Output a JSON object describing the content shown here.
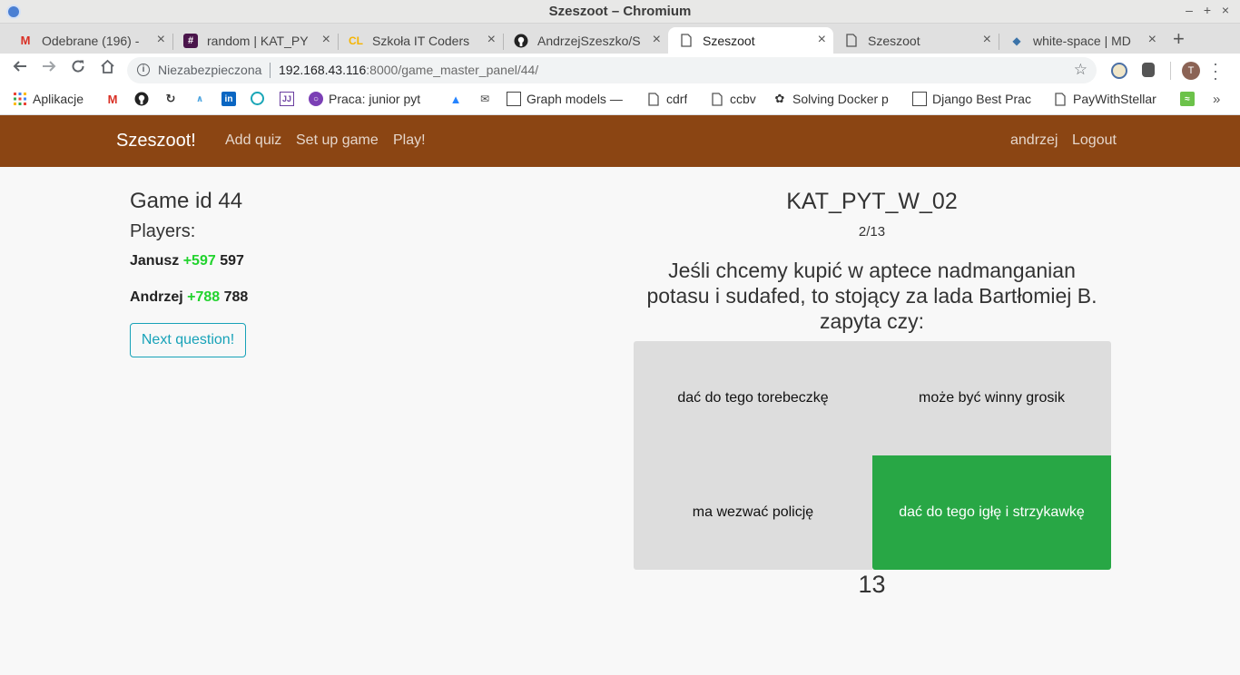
{
  "window": {
    "title": "Szeszoot – Chromium",
    "controls": {
      "minimize": "–",
      "maximize": "+",
      "close": "×"
    }
  },
  "tabs": [
    {
      "label": "Odebrane (196) - ",
      "icon": "gmail-icon",
      "active": false
    },
    {
      "label": "random | KAT_PY",
      "icon": "slack-icon",
      "active": false
    },
    {
      "label": "Szkoła IT Coders",
      "icon": "coderslab-icon",
      "active": false
    },
    {
      "label": "AndrzejSzeszko/S",
      "icon": "github-icon",
      "active": false
    },
    {
      "label": "Szeszoot",
      "icon": "page-icon",
      "active": true
    },
    {
      "label": "Szeszoot",
      "icon": "page-icon",
      "active": false
    },
    {
      "label": "white-space | MD",
      "icon": "mdn-icon",
      "active": false
    }
  ],
  "tab_close_glyph": "×",
  "new_tab_glyph": "+",
  "address": {
    "security_label": "Niezabezpieczona",
    "url_host": "192.168.43.116",
    "url_rest": ":8000/game_master_panel/44/"
  },
  "profile_initial": "T",
  "bookmarks": [
    {
      "label": "Aplikacje",
      "icon": "apps-grid-icon"
    },
    {
      "label": "",
      "icon": "gmail-icon"
    },
    {
      "label": "",
      "icon": "github-icon"
    },
    {
      "label": "",
      "icon": "codewars-icon"
    },
    {
      "label": "",
      "icon": "aws-icon"
    },
    {
      "label": "",
      "icon": "linkedin-icon"
    },
    {
      "label": "",
      "icon": "target-icon"
    },
    {
      "label": "",
      "icon": "jetbrains-icon"
    },
    {
      "label": "Praca: junior pyt",
      "icon": "search-jobs-icon"
    },
    {
      "label": "",
      "icon": "atlassian-icon"
    },
    {
      "label": "",
      "icon": "mail-icon"
    },
    {
      "label": "Graph models —",
      "icon": "doc-grid-icon"
    },
    {
      "label": "cdrf",
      "icon": "page-icon"
    },
    {
      "label": "ccbv",
      "icon": "page-icon"
    },
    {
      "label": "Solving Docker p",
      "icon": "gear-icon"
    },
    {
      "label": "Django Best Prac",
      "icon": "doc-grid-icon"
    },
    {
      "label": "PayWithStellar",
      "icon": "page-icon"
    },
    {
      "label": "",
      "icon": "stellar-icon"
    }
  ],
  "bookmarks_more": "»",
  "navbar": {
    "brand": "Szeszoot!",
    "links": [
      "Add quiz",
      "Set up game",
      "Play!"
    ],
    "user": "andrzej",
    "logout": "Logout"
  },
  "panel": {
    "game_id": "Game id 44",
    "players_heading": "Players:",
    "players": [
      {
        "name": "Janusz",
        "delta": "+597",
        "score": "597"
      },
      {
        "name": "Andrzej",
        "delta": "+788",
        "score": "788"
      }
    ],
    "next_button": "Next question!"
  },
  "quiz": {
    "title": "KAT_PYT_W_02",
    "progress": "2/13",
    "question": "Jeśli chcemy kupić w aptece nadmanganian potasu i sudafed, to stojący za lada Bartłomiej B. zapyta czy:",
    "answers": [
      {
        "text": "dać do tego torebeczkę",
        "correct": false
      },
      {
        "text": "może być winny grosik",
        "correct": false
      },
      {
        "text": "ma wezwać policję",
        "correct": false
      },
      {
        "text": "dać do tego igłę i strzykawkę",
        "correct": true
      }
    ],
    "timer": "13",
    "correct_color": "#28a745"
  },
  "colors": {
    "navbar_bg": "#8b4513",
    "delta_green": "#22d32e",
    "info_button": "#17a2b8"
  }
}
